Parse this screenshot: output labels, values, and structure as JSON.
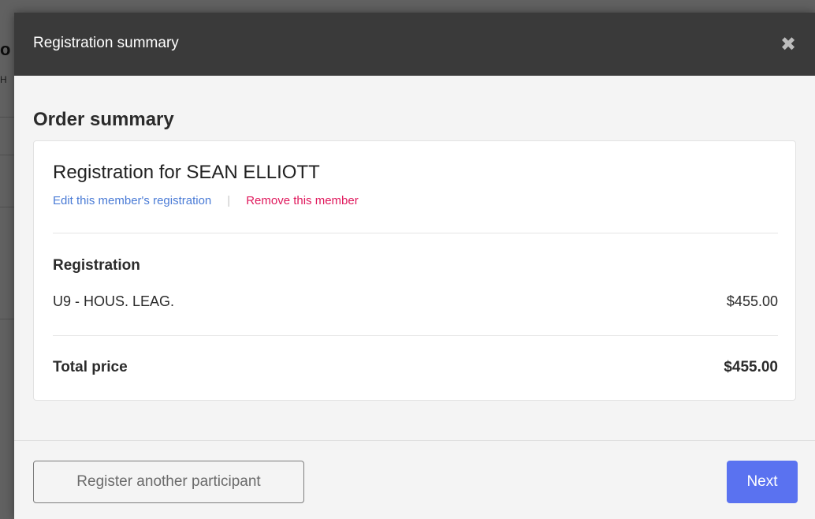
{
  "background": {
    "heading_fragment": "o",
    "subheading_fragment": "H"
  },
  "modal": {
    "title": "Registration summary",
    "close_icon": "close-icon",
    "close_glyph": "✖"
  },
  "order": {
    "title": "Order summary",
    "member": {
      "name": "Registration for SEAN ELLIOTT",
      "edit_label": "Edit this member's registration",
      "remove_label": "Remove this member"
    },
    "section_label": "Registration",
    "items": [
      {
        "name": "U9 - HOUS. LEAG.",
        "price": "$455.00"
      }
    ],
    "total_label": "Total price",
    "total_value": "$455.00"
  },
  "footer": {
    "secondary_label": "Register another participant",
    "primary_label": "Next"
  },
  "colors": {
    "header_bg": "#3a3a3a",
    "link_blue": "#4a7bd6",
    "link_red": "#e0185c",
    "primary_button": "#5a72f0"
  }
}
